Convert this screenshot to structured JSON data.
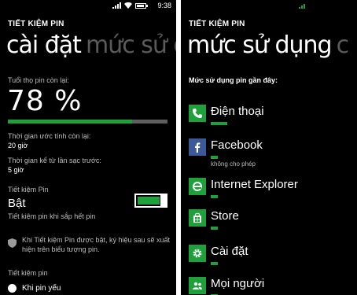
{
  "left": {
    "status": {
      "time": "9:38"
    },
    "app_title": "TIẾT KIỆM PIN",
    "pivot": {
      "active": "cài đặt",
      "next": "mức sử d"
    },
    "battery_life_label": "Tuổi thọ pin còn lại:",
    "battery_percent": "78 %",
    "battery_level_fraction": 0.78,
    "est_time_label": "Thời gian ước tính còn lại:",
    "est_time_value": "20 giờ",
    "since_charge_label": "Thời gian kể từ lần sạc trước:",
    "since_charge_value": "5 giờ",
    "saver_label": "Tiết kiệm Pin",
    "saver_state": "Bật",
    "saver_hint": "Tiết kiệm pin khi sắp hết pin",
    "saver_note": "Khi Tiết kiệm Pin được bật, ký hiệu sau sẽ xuất hiện trên biểu tượng pin.",
    "saver_mode_label": "Tiết kiệm pin",
    "saver_mode_option": "Khi pin yếu"
  },
  "right": {
    "app_title": "TIẾT KIỆM PIN",
    "pivot": {
      "active": "mức sử dụng",
      "next": "c"
    },
    "usage_title": "Mức sử dụng pin gần đây:",
    "apps": [
      {
        "name": "Điện thoại",
        "icon": "phone-icon",
        "usage": 0.16,
        "note": ""
      },
      {
        "name": "Facebook",
        "icon": "facebook-icon",
        "usage": 0.07,
        "note": "không cho phép"
      },
      {
        "name": "Internet Explorer",
        "icon": "internet-explorer-icon",
        "usage": 0.07,
        "note": ""
      },
      {
        "name": "Store",
        "icon": "store-icon",
        "usage": 0.07,
        "note": ""
      },
      {
        "name": "Cài đặt",
        "icon": "settings-gear-icon",
        "usage": 0.07,
        "note": ""
      },
      {
        "name": "Mọi người",
        "icon": "people-icon",
        "usage": 0.07,
        "note": ""
      }
    ]
  },
  "colors": {
    "accent": "#1ea13a",
    "facebook": "#3b5998",
    "track": "#5f5f5f"
  }
}
